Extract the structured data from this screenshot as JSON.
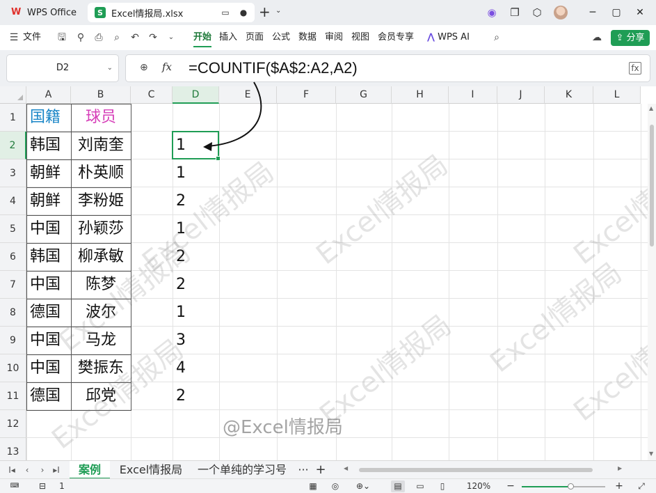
{
  "titlebar": {
    "home_tab": "WPS Office",
    "file_tab": "Excel情报局.xlsx",
    "file_badge": "S"
  },
  "ribbon": {
    "file_menu": "文件",
    "tabs": [
      "开始",
      "插入",
      "页面",
      "公式",
      "数据",
      "审阅",
      "视图",
      "会员专享"
    ],
    "active_tab": "开始",
    "ai_label": "WPS AI",
    "share_label": "分享"
  },
  "formula_bar": {
    "cell_ref": "D2",
    "fx_label": "fx",
    "formula": "=COUNTIF($A$2:A2,A2)"
  },
  "grid": {
    "columns": [
      "A",
      "B",
      "C",
      "D",
      "E",
      "F",
      "G",
      "H",
      "I",
      "J",
      "K",
      "L"
    ],
    "rows": [
      "1",
      "2",
      "3",
      "4",
      "5",
      "6",
      "7",
      "8",
      "9",
      "10",
      "11",
      "12",
      "13"
    ],
    "header": {
      "a": "国籍",
      "b": "球员"
    },
    "data": [
      {
        "a": "韩国",
        "b": "刘南奎",
        "d": "1"
      },
      {
        "a": "朝鲜",
        "b": "朴英顺",
        "d": "1"
      },
      {
        "a": "朝鲜",
        "b": "李粉姫",
        "d": "2"
      },
      {
        "a": "中国",
        "b": "孙颖莎",
        "d": "1"
      },
      {
        "a": "韩国",
        "b": "柳承敏",
        "d": "2"
      },
      {
        "a": "中国",
        "b": "陈梦",
        "d": "2"
      },
      {
        "a": "德国",
        "b": "波尔",
        "d": "1"
      },
      {
        "a": "中国",
        "b": "马龙",
        "d": "3"
      },
      {
        "a": "中国",
        "b": "樊振东",
        "d": "4"
      },
      {
        "a": "德国",
        "b": "邱党",
        "d": "2"
      }
    ],
    "selected_col": "D",
    "selected_row": "2",
    "colors": {
      "header_a": "#1a86c7",
      "header_b": "#d63db8",
      "accent": "#1f9d55"
    }
  },
  "watermark": {
    "text": "Excel情报局",
    "author": "@Excel情报局"
  },
  "sheets": {
    "tabs": [
      "案例",
      "Excel情报局",
      "一个单纯的学习号"
    ],
    "active": "案例",
    "more": "···",
    "add": "+"
  },
  "statusbar": {
    "count": "1",
    "zoom": "120%",
    "minus": "−",
    "plus": "+"
  }
}
